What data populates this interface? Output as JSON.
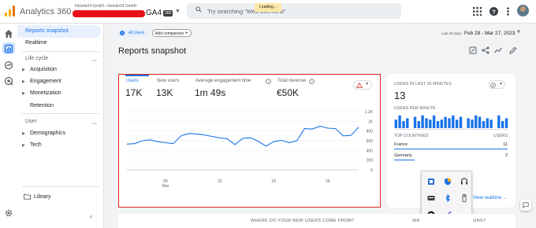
{
  "app": {
    "title": "Analytics 360",
    "account_path": "kfzteile24 GmbH  ›  kfzteile24 GmbH",
    "property_name": "GA4",
    "property_badge": "360",
    "search_placeholder": "Try searching \"Web overview\"",
    "loading_text": "Loading..."
  },
  "nav": {
    "reports_snapshot": "Reports snapshot",
    "realtime": "Realtime",
    "life_cycle": "Life cycle",
    "acquisition": "Acquisition",
    "engagement": "Engagement",
    "monetization": "Monetization",
    "retention": "Retention",
    "user": "User",
    "demographics": "Demographics",
    "tech": "Tech",
    "library": "Library"
  },
  "toolbar": {
    "all_users": "All Users",
    "add_comparison": "Add comparison",
    "date_label": "Last 28 days",
    "date_range": "Feb 28 - Mar 27, 2023",
    "page_title": "Reports snapshot"
  },
  "metrics": [
    {
      "label": "Users",
      "value": "17K"
    },
    {
      "label": "New users",
      "value": "13K"
    },
    {
      "label": "Average engagement time",
      "value": "1m 49s"
    },
    {
      "label": "Total revenue",
      "value": "€50K"
    }
  ],
  "chart_data": {
    "type": "line",
    "x_ticks": [
      "05\nMar",
      "12",
      "19",
      "26"
    ],
    "y_ticks": [
      "1.2K",
      "1K",
      "800",
      "600",
      "400",
      "200",
      "0"
    ],
    "ylim": [
      0,
      1200
    ],
    "series": [
      {
        "values": [
          530,
          540,
          600,
          620,
          580,
          560,
          540,
          700,
          750,
          740,
          720,
          690,
          660,
          640,
          520,
          650,
          660,
          590,
          490,
          580,
          610,
          560,
          600,
          850,
          840,
          900,
          860,
          850,
          700,
          710,
          880
        ]
      }
    ]
  },
  "realtime": {
    "users_header": "USERS IN LAST 30 MINUTES",
    "users_value": "13",
    "per_minute_header": "USERS PER MINUTE",
    "per_minute": [
      0.6,
      0.9,
      0.5,
      0.7,
      0,
      0.8,
      0.5,
      0.9,
      0.7,
      0.6,
      0.9,
      0.5,
      0.6,
      0.8,
      0.7,
      0.9,
      0.6,
      0.8,
      0,
      0.7,
      0.6,
      0.9,
      0.8,
      0.5,
      0.7,
      0.6,
      0,
      0.9,
      0.5,
      0.7
    ],
    "countries_header": "TOP COUNTRIES",
    "users_col_header": "USERS",
    "countries": [
      {
        "name": "France",
        "users": "11",
        "share": 1.0
      },
      {
        "name": "Germany",
        "users": "2",
        "share": 0.18
      }
    ],
    "view_link": "View realtime"
  },
  "bottom": {
    "left_heading": "WHERE DO YOUR NEW USERS COME FROM?",
    "right_heading_start": "WH",
    "right_heading_end": "GNS?"
  },
  "colors": {
    "accent": "#1a73e8",
    "highlight_border": "#e1211e",
    "redaction": "#e8111b"
  }
}
